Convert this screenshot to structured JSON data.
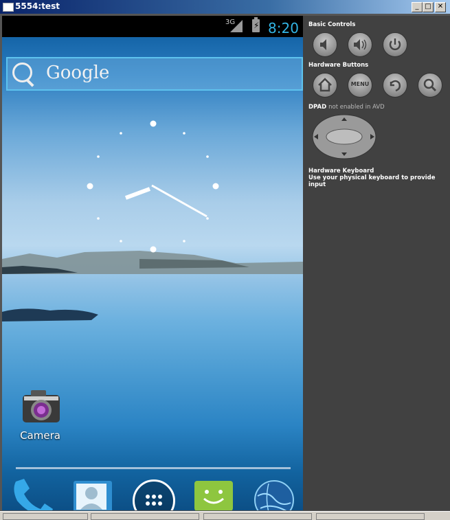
{
  "window": {
    "title": "5554:test",
    "minimize": "_",
    "maximize": "□",
    "close": "✕"
  },
  "status_bar": {
    "network": "3G",
    "time": "8:20"
  },
  "search_bar": {
    "label": "Google"
  },
  "apps": [
    {
      "name": "Camera",
      "icon": "camera-icon"
    }
  ],
  "dock": [
    {
      "icon": "phone-icon"
    },
    {
      "icon": "contacts-icon"
    },
    {
      "icon": "app-drawer-icon"
    },
    {
      "icon": "messaging-icon"
    },
    {
      "icon": "browser-globe-icon"
    }
  ],
  "panel": {
    "basic_controls": "Basic Controls",
    "hardware_buttons": "Hardware Buttons",
    "menu_label": "MENU",
    "dpad_label": "DPAD",
    "dpad_note": "not enabled in AVD",
    "keyboard_title": "Hardware Keyboard",
    "keyboard_text": "Use your physical keyboard to provide input"
  },
  "colors": {
    "accent": "#33b5e5",
    "panel_bg": "#414141",
    "titlebar": "#0a246a"
  }
}
